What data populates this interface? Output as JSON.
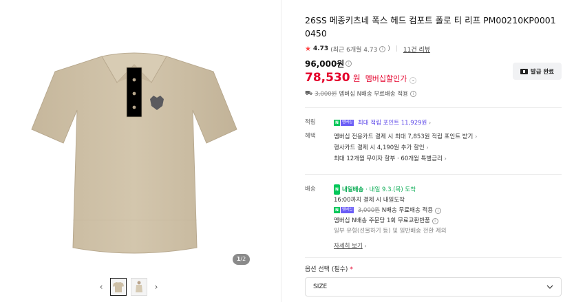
{
  "gallery": {
    "counter_current": "1",
    "counter_total": "/2",
    "prev_label": "‹",
    "next_label": "›"
  },
  "product": {
    "title": "26SS 메종키츠네 폭스 헤드 컴포트 폴로 티 리프 PM00210KP0001 0450",
    "rating_score": "4.73",
    "rating_recent": "(최근 6개월 4.73",
    "rating_recent_close": ")",
    "review_count": "11건 리뷰",
    "original_price": "96,000원",
    "sale_price": "78,530",
    "sale_unit": "원",
    "sale_label": "멤버십할인가",
    "coupon_button": "발급 완료",
    "shipping_strike": "3,000원",
    "shipping_text": "멤버십 N배송 무료배송 적용"
  },
  "benefits": {
    "points_label": "적립",
    "points_text": "최대 적립 포인트 11,929원",
    "perks_label": "혜택",
    "perks": [
      "멤버십 전용카드 결제 시 최대 7,853원 적립 포인트 받기",
      "행사카드 결제 시 4,190원 추가 할인",
      "최대 12개월 무이자 할부 · 60개월 특별금리"
    ]
  },
  "delivery": {
    "label": "배송",
    "badge": "내일배송",
    "eta": "· 내일 9.3.(목) 도착",
    "cutoff": "16:00까지 결제 시 내일도착",
    "free_strike": "3,000원",
    "free_text": "N배송 무료배송 적용",
    "exchange": "멤버십 N배송 주문당 1회 무료교환반품",
    "exception": "일부 유형(선물하기 등) 및 일반배송 전환 제외",
    "details_link": "자세히 보기"
  },
  "option": {
    "label": "옵션 선택 (필수)",
    "required_mark": "*",
    "select_value": "SIZE"
  },
  "npay_badge": {
    "n": "N",
    "plus": "멤버십"
  },
  "colors": {
    "sale_red": "#e4002b",
    "npay_green": "#03c75a",
    "membership_purple": "#6a5cf6",
    "shirt_beige": "#cdbfa6"
  }
}
